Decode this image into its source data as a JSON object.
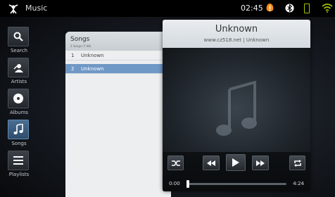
{
  "statusbar": {
    "app_title": "Music",
    "clock": "02:45"
  },
  "nav": {
    "items": [
      {
        "label": "Search",
        "icon": "search-icon"
      },
      {
        "label": "Artists",
        "icon": "artist-icon"
      },
      {
        "label": "Albums",
        "icon": "disc-icon"
      },
      {
        "label": "Songs",
        "icon": "music-note-icon",
        "active": true
      },
      {
        "label": "Playlists",
        "icon": "list-icon"
      }
    ]
  },
  "songs": {
    "title": "Songs",
    "subtitle": "2 Songs (7:48)",
    "rows": [
      {
        "num": "1",
        "name": "Unknown",
        "selected": false
      },
      {
        "num": "2",
        "name": "Unknown",
        "selected": true
      }
    ]
  },
  "player": {
    "title": "Unknown",
    "subtitle": "www.cz518.net | Unknown",
    "time_current": "0:00",
    "time_total": "4:24",
    "progress": 0.0
  },
  "colors": {
    "accent": "#6f98c6",
    "battery": "#a5c400"
  }
}
